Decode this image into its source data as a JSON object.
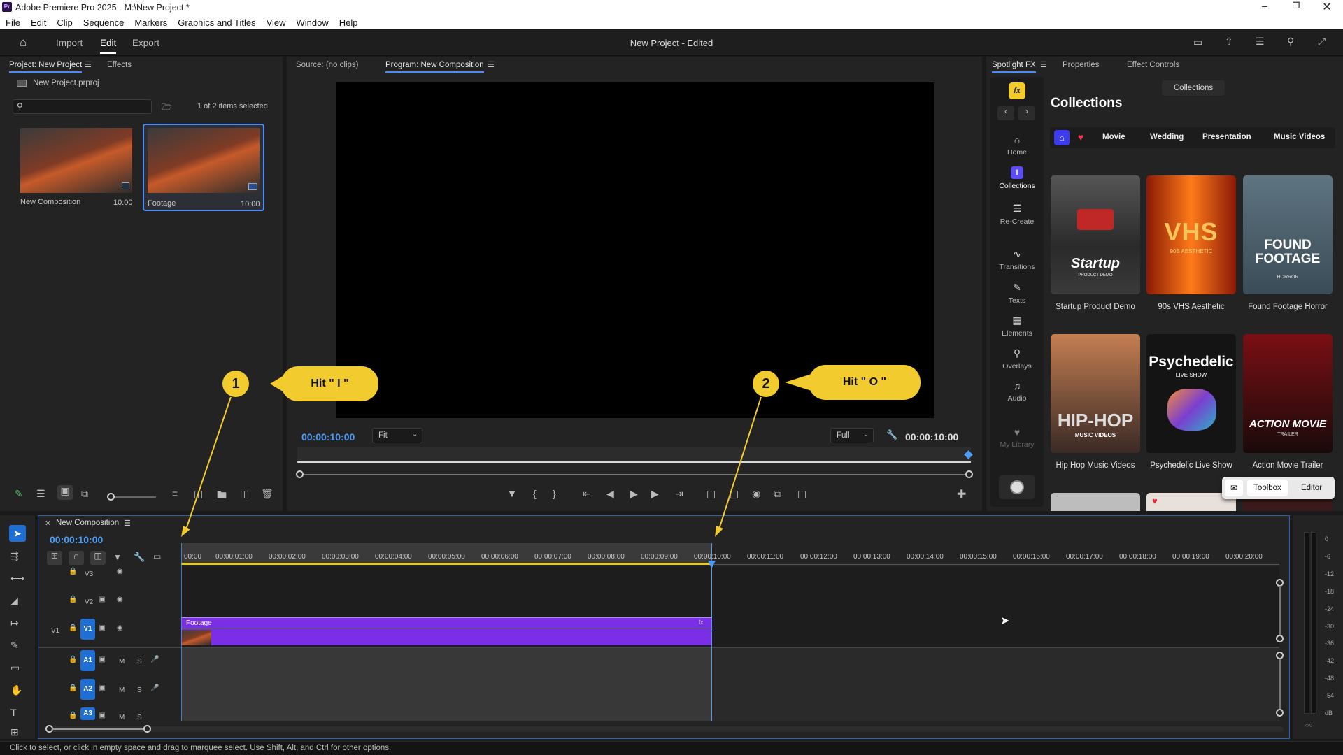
{
  "window": {
    "title": "Adobe Premiere Pro 2025 - M:\\New Project *",
    "app_badge": "Pr"
  },
  "menu": [
    "File",
    "Edit",
    "Clip",
    "Sequence",
    "Markers",
    "Graphics and Titles",
    "View",
    "Window",
    "Help"
  ],
  "workspace_tabs": [
    "Import",
    "Edit",
    "Export"
  ],
  "project_title": "New Project - Edited",
  "project_panel": {
    "tabs": [
      "Project: New Project",
      "Effects"
    ],
    "file": "New Project.prproj",
    "selection": "1 of 2 items selected",
    "items": [
      {
        "name": "New Composition",
        "duration": "10:00"
      },
      {
        "name": "Footage",
        "duration": "10:00"
      }
    ]
  },
  "monitor": {
    "source_tab": "Source: (no clips)",
    "program_tab": "Program: New Composition",
    "timecode_left": "00:00:10:00",
    "fit": "Fit",
    "quality": "Full",
    "timecode_right": "00:00:10:00"
  },
  "spotlight": {
    "tabs": [
      "Spotlight FX",
      "Properties",
      "Effect Controls"
    ],
    "fx_badge": "fx",
    "collections_button": "Collections",
    "heading": "Collections",
    "filters": [
      "Movie",
      "Wedding",
      "Presentation",
      "Music Videos"
    ],
    "nav": [
      "Home",
      "Collections",
      "Re-Create",
      "Transitions",
      "Texts",
      "Elements",
      "Overlays",
      "Audio",
      "My Library"
    ],
    "cards": [
      {
        "label": "Startup Product Demo",
        "art": "Startup",
        "sub": "PRODUCT DEMO"
      },
      {
        "label": "90s VHS Aesthetic",
        "art": "VHS",
        "sub": "90S AESTHETIC"
      },
      {
        "label": "Found Footage Horror",
        "art": "FOUND FOOTAGE",
        "sub": "HORROR"
      },
      {
        "label": "Hip Hop Music Videos",
        "art": "HIP-HOP",
        "sub": "MUSIC VIDEOS"
      },
      {
        "label": "Psychedelic Live Show",
        "art": "Psychedelic",
        "sub": "LIVE SHOW"
      },
      {
        "label": "Action Movie Trailer",
        "art": "ACTION MOVIE",
        "sub": "TRAILER"
      }
    ],
    "toolbox": "Toolbox",
    "editor": "Editor"
  },
  "timeline": {
    "sequence_tab": "New Composition",
    "timecode": "00:00:10:00",
    "ruler": [
      "00:00",
      "00:00:01:00",
      "00:00:02:00",
      "00:00:03:00",
      "00:00:04:00",
      "00:00:05:00",
      "00:00:06:00",
      "00:00:07:00",
      "00:00:08:00",
      "00:00:09:00",
      "00:00:10:00",
      "00:00:11:00",
      "00:00:12:00",
      "00:00:13:00",
      "00:00:14:00",
      "00:00:15:00",
      "00:00:16:00",
      "00:00:17:00",
      "00:00:18:00",
      "00:00:19:00",
      "00:00:20:00"
    ],
    "tracks": {
      "v3": "V3",
      "v2": "V2",
      "v1_src": "V1",
      "v1": "V1",
      "a1": "A1",
      "a2": "A2",
      "a3": "A3",
      "m": "M",
      "s": "S"
    },
    "clip_label": "Footage",
    "meter_scale": [
      "0",
      "-6",
      "-12",
      "-18",
      "-24",
      "-30",
      "-36",
      "-42",
      "-48",
      "-54",
      "dB"
    ]
  },
  "annotations": [
    {
      "num": "1",
      "text": "Hit \" I \""
    },
    {
      "num": "2",
      "text": "Hit \" O \""
    }
  ],
  "status_bar": "Click to select, or click in empty space and drag to marquee select. Use Shift, Alt, and Ctrl for other options."
}
